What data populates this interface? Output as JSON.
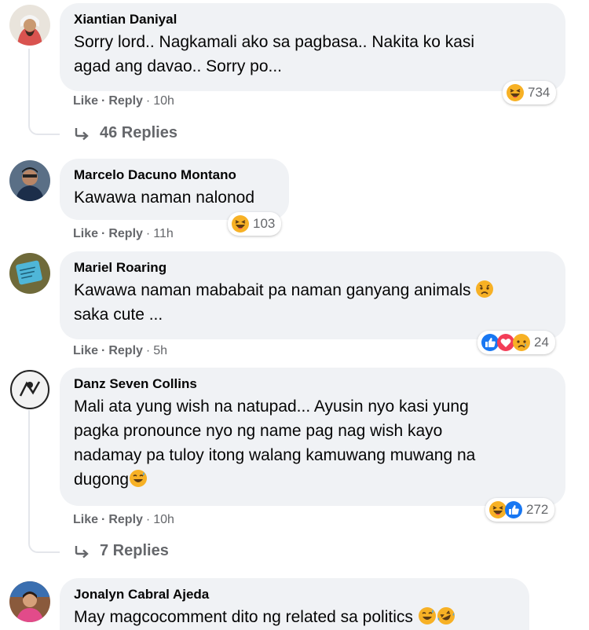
{
  "comments": [
    {
      "author": "Xiantian Daniyal",
      "lines": [
        "Sorry lord.. Nagkamali ako sa pagbasa.. Nakita ko kasi",
        "agad ang davao.. Sorry po..."
      ],
      "actions": {
        "like": "Like",
        "reply": "Reply",
        "time": "10h",
        "sep": "·"
      },
      "reactions": {
        "icons": [
          "haha-icon"
        ],
        "count": "734"
      },
      "replies_label": "46 Replies"
    },
    {
      "author": "Marcelo Dacuno Montano",
      "lines": [
        "Kawawa naman nalonod"
      ],
      "actions": {
        "like": "Like",
        "reply": "Reply",
        "time": "11h",
        "sep": "·"
      },
      "reactions": {
        "icons": [
          "haha-icon"
        ],
        "count": "103"
      }
    },
    {
      "author": "Mariel Roaring",
      "lines": [
        "Kawawa naman mababait pa naman ganyang animals",
        "saka cute ..."
      ],
      "line_emoji": [
        "sad-emoji",
        ""
      ],
      "actions": {
        "like": "Like",
        "reply": "Reply",
        "time": "5h",
        "sep": "·"
      },
      "reactions": {
        "icons": [
          "like-icon",
          "love-icon",
          "sad-icon"
        ],
        "count": "24"
      }
    },
    {
      "author": "Danz Seven Collins",
      "lines": [
        "Mali ata yung wish na natupad... Ayusin nyo kasi yung",
        "pagka pronounce nyo ng name pag nag wish kayo",
        "nadamay pa tuloy itong walang kamuwang muwang na",
        "dugong"
      ],
      "line_emoji": [
        "",
        "",
        "",
        "sweat-smile-emoji"
      ],
      "actions": {
        "like": "Like",
        "reply": "Reply",
        "time": "10h",
        "sep": "·"
      },
      "reactions": {
        "icons": [
          "haha-icon",
          "like-icon"
        ],
        "count": "272"
      },
      "replies_label": "7 Replies"
    },
    {
      "author": "Jonalyn Cabral Ajeda",
      "lines": [
        "May magcocomment dito ng related sa politics"
      ],
      "line_emoji": [
        "sweat-smile-emoji rofl-emoji"
      ]
    }
  ],
  "colors": {
    "bubble": "#f0f2f5",
    "meta": "#65676b",
    "text": "#050505",
    "like_blue": "#1877f2",
    "love_red": "#f33e58",
    "haha_yellow": "#f7b125"
  }
}
